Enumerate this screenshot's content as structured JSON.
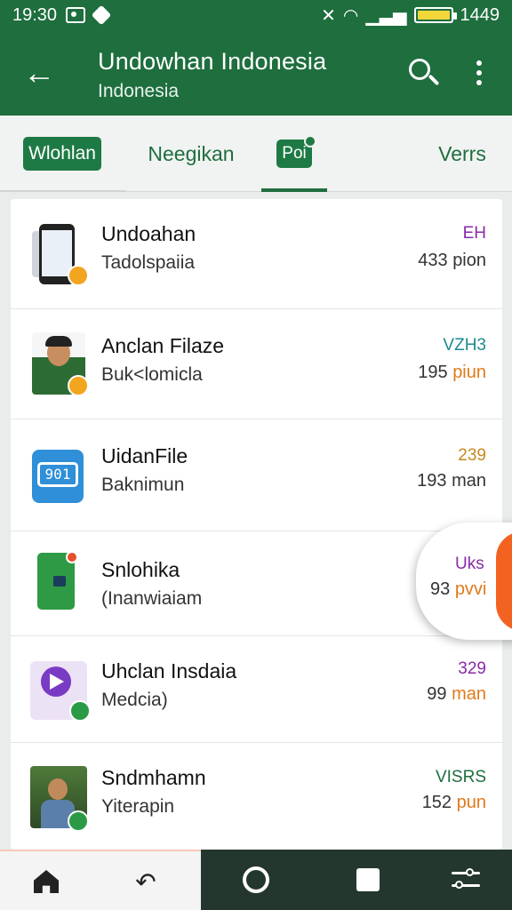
{
  "status_bar": {
    "time": "19:30",
    "clock": "1449",
    "colors": {
      "background": "#1e6e3e",
      "battery": "#f2d63a"
    }
  },
  "app_bar": {
    "title": "Undowhan Indonesia",
    "subtitle": "Indonesia",
    "colors": {
      "background": "#1e6e3e"
    }
  },
  "tabs": [
    {
      "label": "Wlohlan",
      "style": "pill"
    },
    {
      "label": "Neegikan",
      "style": "plain"
    },
    {
      "label": "Poi",
      "style": "pill-small",
      "selected": true
    },
    {
      "label": "Verrs",
      "style": "plain"
    }
  ],
  "list": [
    {
      "title": "Undoahan",
      "subtitle": "Tadolspaiia",
      "tag": "EH",
      "tag_color": "#8a2aa8",
      "meta_value": "433",
      "meta_unit": "pion",
      "thumb_icon": "phone-icon"
    },
    {
      "title": "Anclan Filaze",
      "subtitle": "Buk<lomicla",
      "tag": "VZH3",
      "tag_color": "#1c8b8f",
      "meta_value": "195",
      "meta_unit": "piun",
      "thumb_icon": "person-photo"
    },
    {
      "title": "UidanFile",
      "subtitle": "Baknimun",
      "tag": "239",
      "tag_color": "#c48a1e",
      "meta_value": "193",
      "meta_unit": "man",
      "thumb_icon": "tablet-icon"
    },
    {
      "title": "Snlohika",
      "subtitle": "(Inanwiaiam",
      "tag": "",
      "tag_color": "#8a2aa8",
      "meta_value": "",
      "meta_unit": "",
      "thumb_icon": "green-app-icon"
    },
    {
      "title": "Uhclan Insdaia",
      "subtitle": "Medcia)",
      "tag": "329",
      "tag_color": "#8a2aa8",
      "meta_value": "99",
      "meta_unit": "man",
      "thumb_icon": "media-play-icon"
    },
    {
      "title": "Sndmhamn",
      "subtitle": "Yiterapin",
      "tag": "VISRS",
      "tag_color": "#1e6e3e",
      "meta_value": "152",
      "meta_unit": "pun",
      "thumb_icon": "outdoor-photo"
    }
  ],
  "floating_bubble": {
    "tag": "Uks",
    "meta_value": "93",
    "meta_unit": "pvvi",
    "colors": {
      "accent": "#f26322"
    }
  },
  "bottom_nav": {
    "items": [
      "home-icon",
      "back-icon",
      "circle-icon",
      "square-icon",
      "sliders-icon"
    ],
    "colors": {
      "dark": "#23372e"
    }
  }
}
